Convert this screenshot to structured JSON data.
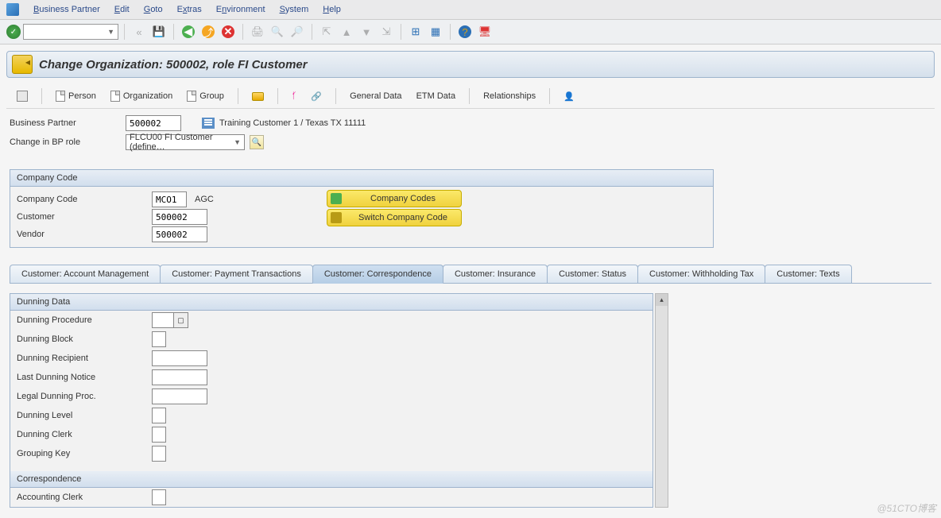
{
  "menubar": {
    "items": [
      {
        "label": "Business Partner",
        "ukey": "B"
      },
      {
        "label": "Edit",
        "ukey": "E"
      },
      {
        "label": "Goto",
        "ukey": "G"
      },
      {
        "label": "Extras",
        "ukey": "x"
      },
      {
        "label": "Environment",
        "ukey": "n"
      },
      {
        "label": "System",
        "ukey": "S"
      },
      {
        "label": "Help",
        "ukey": "H"
      }
    ]
  },
  "title": "Change Organization: 500002, role FI Customer",
  "app_toolbar": {
    "person": "Person",
    "organization": "Organization",
    "group": "Group",
    "general_data": "General Data",
    "etm_data": "ETM Data",
    "relationships": "Relationships"
  },
  "header_fields": {
    "bp_label": "Business Partner",
    "bp_value": "500002",
    "bp_desc": "Training Customer 1 / Texas TX 11111",
    "role_label": "Change in BP role",
    "role_value": "FLCU00 FI Customer (define…"
  },
  "company_panel": {
    "title": "Company Code",
    "rows": {
      "cc_label": "Company Code",
      "cc_value": "MCO1",
      "cc_desc": "AGC",
      "cust_label": "Customer",
      "cust_value": "500002",
      "vend_label": "Vendor",
      "vend_value": "500002"
    },
    "btn_codes": "Company Codes",
    "btn_switch": "Switch Company Code"
  },
  "tabs": [
    "Customer: Account Management",
    "Customer: Payment Transactions",
    "Customer: Correspondence",
    "Customer: Insurance",
    "Customer: Status",
    "Customer: Withholding Tax",
    "Customer: Texts"
  ],
  "active_tab_index": 2,
  "dunning": {
    "title": "Dunning Data",
    "fields": [
      "Dunning Procedure",
      "Dunning Block",
      "Dunning Recipient",
      "Last Dunning Notice",
      "Legal Dunning Proc.",
      "Dunning Level",
      "Dunning Clerk",
      "Grouping Key"
    ]
  },
  "correspondence": {
    "title": "Correspondence",
    "fields": [
      "Accounting Clerk"
    ]
  },
  "watermark": "@51CTO博客"
}
